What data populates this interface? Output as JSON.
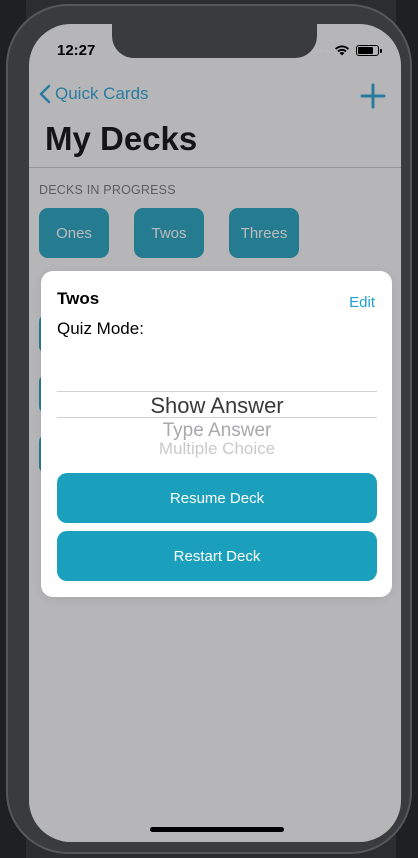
{
  "status_bar": {
    "time": "12:27"
  },
  "nav": {
    "back_label": "Quick Cards",
    "title": "My Decks"
  },
  "section_header": "DECKS IN PROGRESS",
  "decks": [
    "Ones",
    "Twos",
    "Threes"
  ],
  "modal": {
    "deck_name": "Twos",
    "edit_label": "Edit",
    "quiz_mode_label": "Quiz Mode:",
    "picker_options": [
      "Show Answer",
      "Type Answer",
      "Multiple Choice"
    ],
    "resume_label": "Resume Deck",
    "restart_label": "Restart Deck"
  },
  "colors": {
    "accent": "#1a9fbc",
    "link": "#1f9fd1"
  }
}
